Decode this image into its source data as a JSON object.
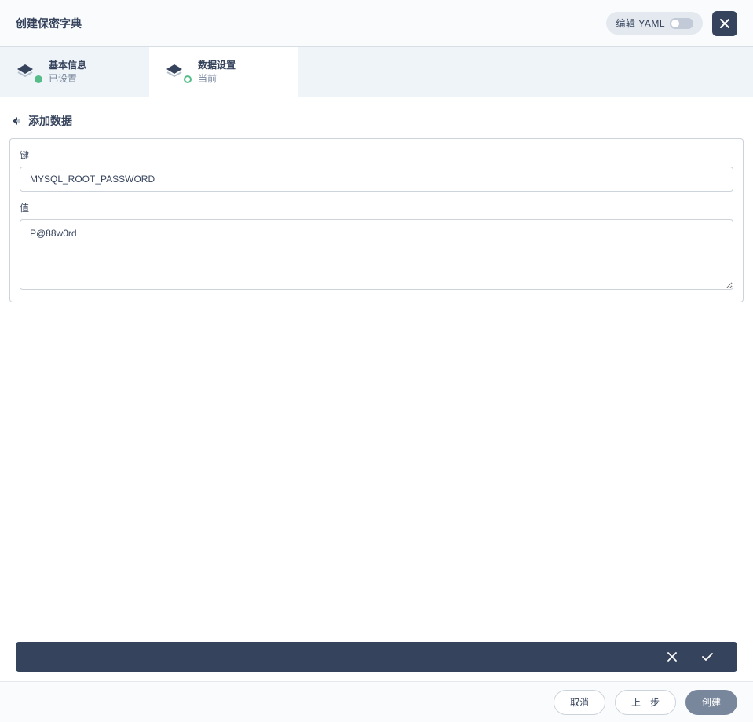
{
  "header": {
    "title": "创建保密字典",
    "yaml_label": "编辑 YAML"
  },
  "steps": [
    {
      "title": "基本信息",
      "status": "已设置"
    },
    {
      "title": "数据设置",
      "status": "当前"
    }
  ],
  "section": {
    "title": "添加数据"
  },
  "form": {
    "key_label": "键",
    "key_value": "MYSQL_ROOT_PASSWORD",
    "value_label": "值",
    "value_value": "P@88w0rd"
  },
  "footer": {
    "cancel": "取消",
    "previous": "上一步",
    "create": "创建"
  }
}
